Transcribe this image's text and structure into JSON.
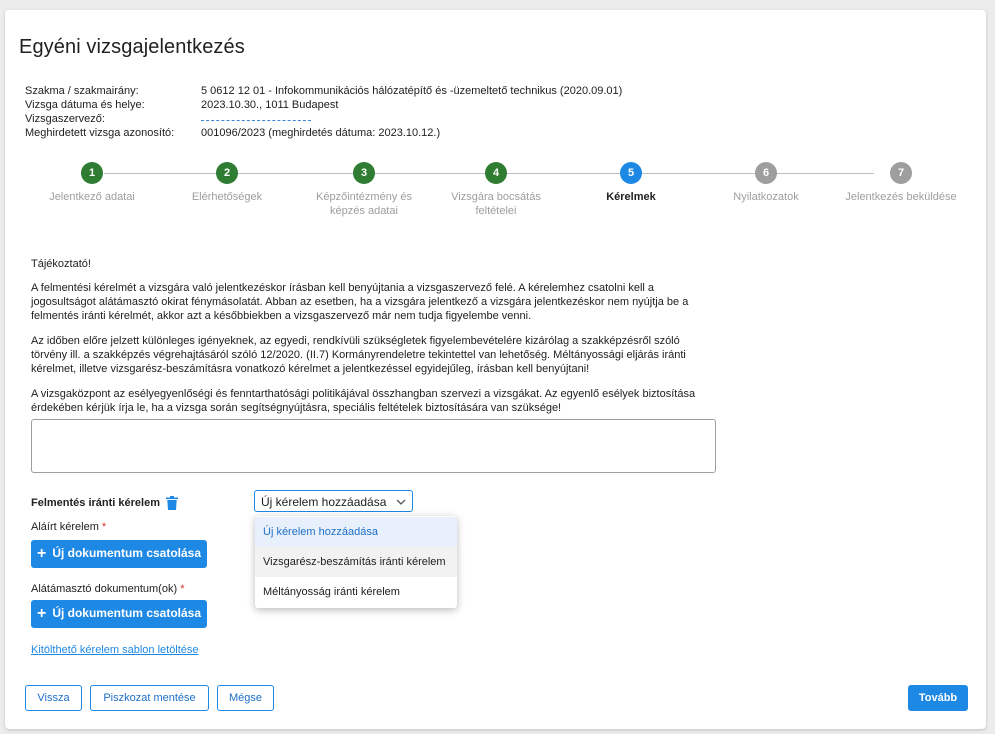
{
  "title": "Egyéni vizsgajelentkezés",
  "info": [
    {
      "key": "Szakma / szakmairány:",
      "value": "5 0612 12 01 - Infokommunikációs hálózatépítő és -üzemeltető technikus (2020.09.01)"
    },
    {
      "key": "Vizsga dátuma és helye:",
      "value": "2023.10.30., 1011 Budapest"
    },
    {
      "key": "Vizsgaszervező:",
      "value": ""
    },
    {
      "key": "Meghirdetett vizsga azonosító:",
      "value": "001096/2023 (meghirdetés dátuma: 2023.10.12.)"
    }
  ],
  "steps": [
    {
      "num": "1",
      "label": "Jelentkező adatai",
      "state": "done"
    },
    {
      "num": "2",
      "label": "Elérhetőségek",
      "state": "done"
    },
    {
      "num": "3",
      "label": "Képzőintézmény és képzés adatai",
      "state": "done"
    },
    {
      "num": "4",
      "label": "Vizsgára bocsátás feltételei",
      "state": "done"
    },
    {
      "num": "5",
      "label": "Kérelmek",
      "state": "active"
    },
    {
      "num": "6",
      "label": "Nyilatkozatok",
      "state": "todo"
    },
    {
      "num": "7",
      "label": "Jelentkezés beküldése",
      "state": "todo"
    }
  ],
  "notice": {
    "heading": "Tájékoztató!",
    "p1": "A felmentési kérelmét a vizsgára való jelentkezéskor írásban kell benyújtania a vizsgaszervező felé. A kérelemhez csatolni kell a jogosultságot alátámasztó okirat fénymásolatát. Abban az esetben, ha a vizsgára jelentkező a vizsgára jelentkezéskor nem nyújtja be a felmentés iránti kérelmét, akkor azt a későbbiekben a vizsgaszervező már nem tudja figyelembe venni.",
    "p2": "Az időben előre jelzett különleges igényeknek, az egyedi, rendkívüli szükségletek figyelembevételére kizárólag a szakképzésről szóló törvény ill. a szakképzés végrehajtásáról szóló 12/2020. (II.7) Kormányrendeletre tekintettel van lehetőség. Méltányossági eljárás iránti kérelmet, illetve vizsgarész-beszámításra vonatkozó kérelmet a jelentkezéssel egyidejűleg, írásban kell benyújtani!",
    "p3": "A vizsgaközpont az esélyegyenlőségi és fenntarthatósági politikájával összhangban szervezi a vizsgákat. Az egyenlő esélyek biztosítása érdekében kérjük írja le, ha a vizsga során segítségnyújtásra, speciális feltételek biztosítására van szüksége!"
  },
  "textarea_value": "",
  "request": {
    "label": "Felmentés iránti kérelem",
    "select_value": "Új kérelem hozzáadása",
    "options": [
      "Új kérelem hozzáadása",
      "Vizsgarész-beszámítás iránti kérelem",
      "Méltányosság iránti kérelem"
    ]
  },
  "signed": {
    "label": "Aláírt kérelem",
    "req": "*",
    "button": "Új dokumentum csatolása"
  },
  "supporting": {
    "label": "Alátámasztó dokumentum(ok)",
    "req": "*",
    "button": "Új dokumentum csatolása"
  },
  "template_link": "Kitölthető kérelem sablon letöltése",
  "footer": {
    "back": "Vissza",
    "draft": "Piszkozat mentése",
    "cancel": "Mégse",
    "next": "Tovább"
  },
  "colors": {
    "accent": "#1e88e5",
    "done": "#2e7d32",
    "todo": "#9e9e9e"
  },
  "icons": {
    "trash": "trash-icon",
    "chevron": "chevron-down-icon",
    "plus": "plus-icon"
  }
}
